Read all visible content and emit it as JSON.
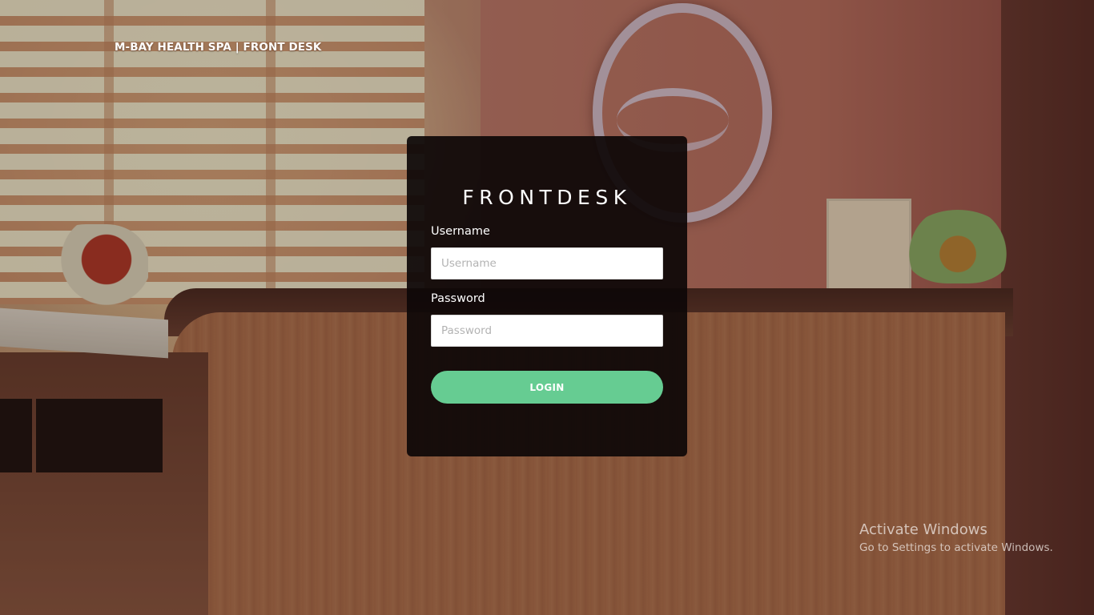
{
  "header": {
    "brand": "M-BAY HEALTH SPA | FRONT DESK"
  },
  "login": {
    "title": "FRONTDESK",
    "username_label": "Username",
    "username_placeholder": "Username",
    "username_value": "",
    "password_label": "Password",
    "password_placeholder": "Password",
    "password_value": "",
    "button_label": "LOGIN"
  },
  "windows_watermark": {
    "title": "Activate Windows",
    "subtitle": "Go to Settings to activate Windows."
  },
  "colors": {
    "card_background": "#0e0807",
    "button_accent": "#66cc92",
    "text": "#ffffff"
  },
  "background": {
    "description_icon": "reception-desk-photo"
  }
}
